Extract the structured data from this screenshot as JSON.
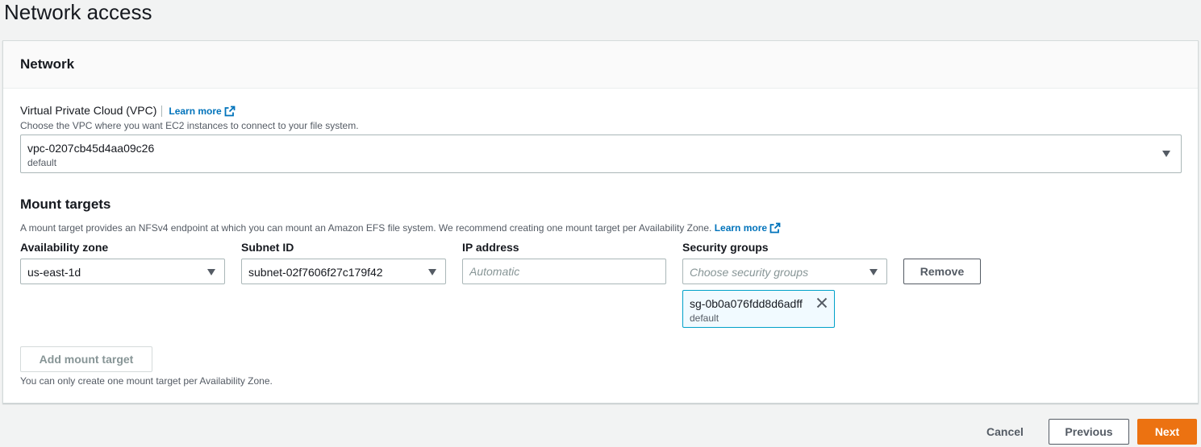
{
  "page": {
    "title": "Network access"
  },
  "panel": {
    "title": "Network"
  },
  "vpc": {
    "label": "Virtual Private Cloud (VPC)",
    "learn_more": "Learn more",
    "description": "Choose the VPC where you want EC2 instances to connect to your file system.",
    "value": "vpc-0207cb45d4aa09c26",
    "sublabel": "default"
  },
  "mount_targets": {
    "title": "Mount targets",
    "description": "A mount target provides an NFSv4 endpoint at which you can mount an Amazon EFS file system. We recommend creating one mount target per Availability Zone.",
    "learn_more": "Learn more",
    "columns": {
      "availability_zone": "Availability zone",
      "subnet_id": "Subnet ID",
      "ip_address": "IP address",
      "security_groups": "Security groups"
    },
    "row": {
      "availability_zone": "us-east-1d",
      "subnet_id": "subnet-02f7606f27c179f42",
      "ip_address_placeholder": "Automatic",
      "security_groups_placeholder": "Choose security groups",
      "remove_label": "Remove",
      "token": {
        "id": "sg-0b0a076fdd8d6adff",
        "sublabel": "default"
      }
    },
    "add_label": "Add mount target",
    "add_hint": "You can only create one mount target per Availability Zone."
  },
  "footer": {
    "cancel_label": "Cancel",
    "previous_label": "Previous",
    "next_label": "Next"
  },
  "colors": {
    "primary": "#ec7211",
    "link": "#0073bb",
    "token_border": "#00a1c9",
    "token_bg": "#f1faff"
  }
}
